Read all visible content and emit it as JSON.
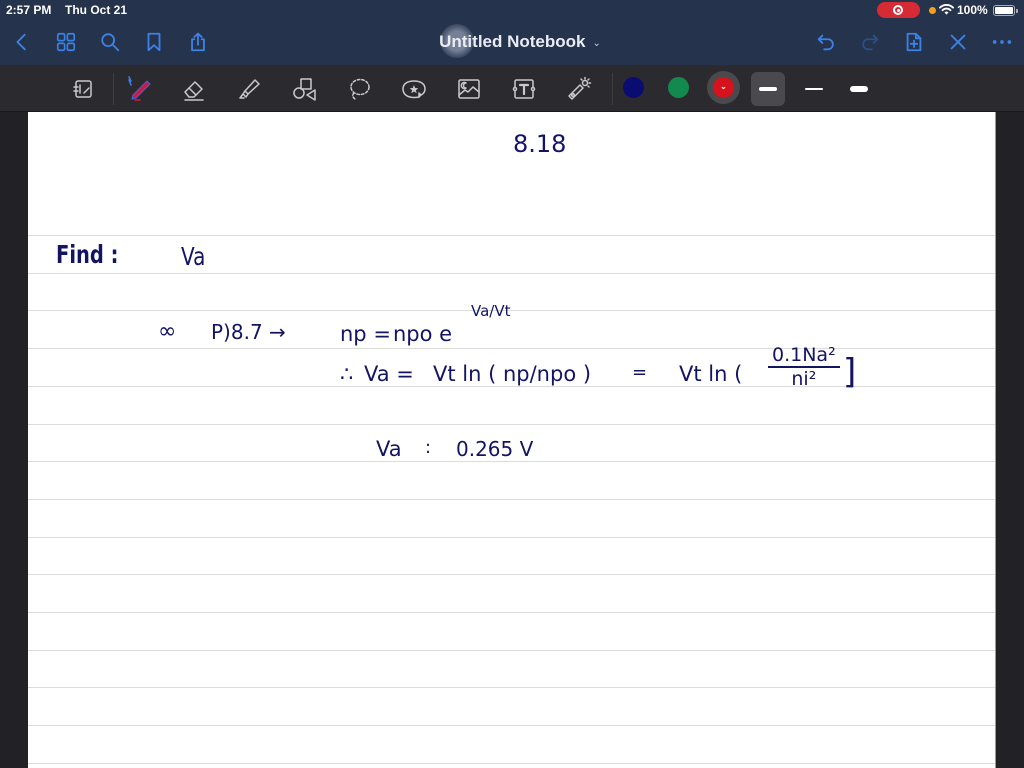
{
  "status_bar": {
    "time": "2:57 PM",
    "date": "Thu Oct 21",
    "battery_percent": "100%",
    "recording": true
  },
  "nav": {
    "left_icons": [
      "back-icon",
      "grid-icon",
      "search-icon",
      "bookmark-icon",
      "share-icon"
    ],
    "title": "Untitled Notebook",
    "title_chevron": "⌄",
    "right_icons": [
      "undo-icon",
      "redo-icon",
      "add-page-icon",
      "close-icon",
      "more-icon"
    ]
  },
  "tools": {
    "items": [
      "page-view-icon",
      "pen-icon",
      "eraser-icon",
      "highlighter-icon",
      "shapes-icon",
      "lasso-icon",
      "sticker-icon",
      "image-icon",
      "text-icon",
      "laser-pointer-icon"
    ],
    "selected_tool": "pen",
    "colors": [
      {
        "name": "navy",
        "hex": "#0b0c72"
      },
      {
        "name": "green",
        "hex": "#12894f"
      },
      {
        "name": "red",
        "hex": "#d6121c"
      }
    ],
    "selected_color": "red",
    "color_chevron": "⌄",
    "stroke_widths": [
      "medium",
      "thin",
      "thick"
    ],
    "selected_stroke": "medium"
  },
  "note": {
    "ink_color": "#131462",
    "lines": {
      "title": "8.18",
      "find_label": "Find :",
      "find_value": "Va",
      "eq1_prefix": "∞",
      "eq1_ref": "P)8.7 →",
      "eq1_lhs": "np =",
      "eq1_rhs": "npo e",
      "eq1_exp": "Va/Vt",
      "eq2_therefore": "∴",
      "eq2_lhs": "Va =",
      "eq2_mid": "Vt ln ( np/npo )",
      "eq2_eq": "=",
      "eq2_rhs_pre": "Vt ln (",
      "eq2_frac_num": "0.1Na²",
      "eq2_frac_den": "ni²",
      "eq2_rhs_post": "]",
      "answer_lhs": "Va",
      "answer_eq": ":",
      "answer_value": "0.265 V"
    }
  }
}
